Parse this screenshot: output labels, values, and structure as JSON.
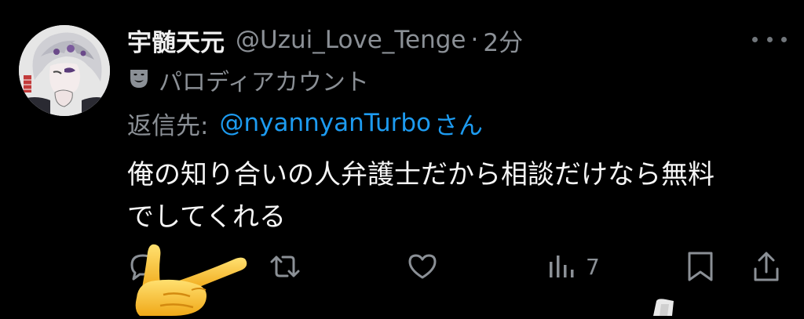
{
  "tweet": {
    "display_name": "宇髄天元",
    "handle": "@Uzui_Love_Tenge",
    "separator": "·",
    "time": "2分",
    "parody_icon": "theater-mask-icon",
    "parody_label": "パロディアカウント",
    "reply_prefix": "返信先:",
    "reply_handle": "@nyannyanTurbo",
    "reply_suffix": "さん",
    "body_lines": [
      "俺の知り合いの人弁護士だから相談だけなら無料",
      "でしてくれる"
    ]
  },
  "actions": {
    "reply_icon": "reply-icon",
    "retweet_icon": "retweet-icon",
    "like_icon": "heart-icon",
    "views_icon": "views-chart-icon",
    "views_count": "7",
    "bookmark_icon": "bookmark-icon",
    "share_icon": "share-icon"
  },
  "colors": {
    "background": "#000000",
    "text_primary": "#e7e9ea",
    "text_secondary": "#71767b",
    "link": "#1d9bf0"
  }
}
